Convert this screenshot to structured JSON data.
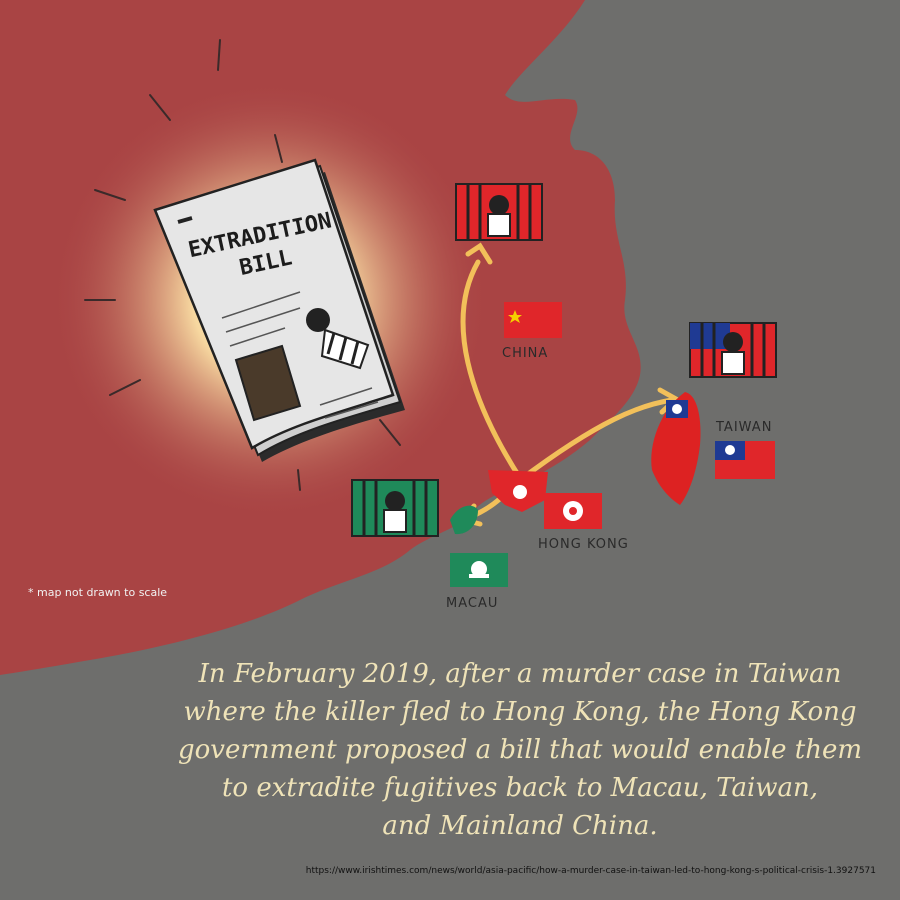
{
  "bill": {
    "title_line1": "EXTRADITION",
    "title_line2": "BILL"
  },
  "map": {
    "china": "CHINA",
    "taiwan": "TAIWAN",
    "hong_kong": "HONG KONG",
    "macau": "MACAU"
  },
  "note": "* map not drawn to scale",
  "caption": {
    "line1": "In February 2019, after a murder case in Taiwan",
    "line2": "where the killer fled to Hong Kong, the Hong Kong",
    "line3": "government proposed a bill that would enable them",
    "line4": "to extradite fugitives back to Macau, Taiwan,",
    "line5": "and Mainland China."
  },
  "source_url": "https://www.irishtimes.com/news/world/asia-pacific/how-a-murder-case-in-taiwan-led-to-hong-kong-s-political-crisis-1.3927571",
  "colors": {
    "land": "#a94444",
    "sea": "#6e6e6c",
    "arrow": "#f2c05a",
    "caption": "#efe3b8"
  }
}
